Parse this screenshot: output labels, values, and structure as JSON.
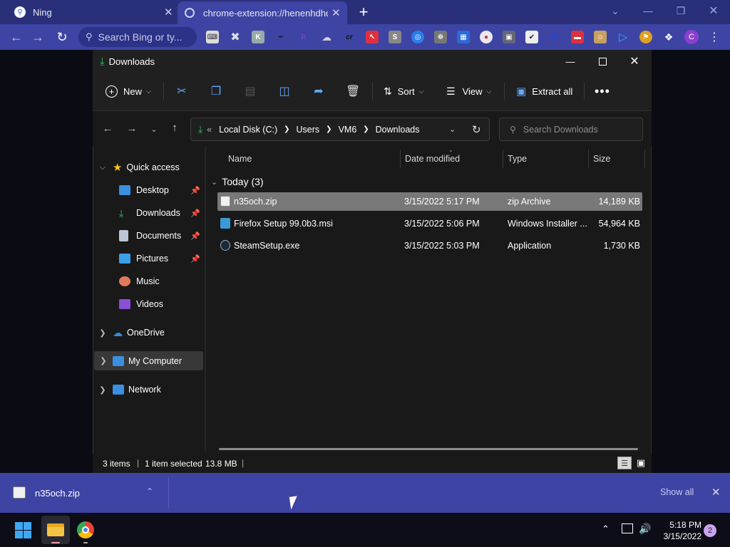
{
  "browser": {
    "tabs": [
      {
        "title": "Ning",
        "icon": "search-icon"
      },
      {
        "title": "chrome-extension://henenhdhdl",
        "icon": "globe-icon"
      }
    ],
    "new_tab": "+",
    "omnibox_placeholder": "Search Bing or ty...",
    "profile_initial": "C",
    "extensions": [
      "⌨",
      "✖",
      "K",
      "✒",
      "R",
      "☁",
      "cr",
      "↖",
      "S",
      "◎",
      "☸",
      "▦",
      "●",
      "▣",
      "✔",
      "R",
      "▬",
      "☺",
      "▷",
      "⚑"
    ]
  },
  "explorer": {
    "title": "Downloads",
    "commands": {
      "new": "New",
      "sort": "Sort",
      "view": "View",
      "extract_all": "Extract all"
    },
    "address": {
      "prefix": "«",
      "crumbs": [
        "Local Disk (C:)",
        "Users",
        "VM6",
        "Downloads"
      ]
    },
    "search_placeholder": "Search Downloads",
    "sidebar": {
      "quick_access": "Quick access",
      "quick_items": [
        {
          "label": "Desktop",
          "pinned": true
        },
        {
          "label": "Downloads",
          "pinned": true
        },
        {
          "label": "Documents",
          "pinned": true
        },
        {
          "label": "Pictures",
          "pinned": true
        },
        {
          "label": "Music",
          "pinned": false
        },
        {
          "label": "Videos",
          "pinned": false
        }
      ],
      "onedrive": "OneDrive",
      "my_computer": "My Computer",
      "network": "Network"
    },
    "columns": {
      "name": "Name",
      "date": "Date modified",
      "type": "Type",
      "size": "Size"
    },
    "group": "Today (3)",
    "files": [
      {
        "name": "n35och.zip",
        "date": "3/15/2022 5:17 PM",
        "type": "zip Archive",
        "size": "14,189 KB",
        "selected": true
      },
      {
        "name": "Firefox Setup 99.0b3.msi",
        "date": "3/15/2022 5:06 PM",
        "type": "Windows Installer ...",
        "size": "54,964 KB",
        "selected": false
      },
      {
        "name": "SteamSetup.exe",
        "date": "3/15/2022 5:03 PM",
        "type": "Application",
        "size": "1,730 KB",
        "selected": false
      }
    ],
    "status": {
      "items": "3 items",
      "selected": "1 item selected",
      "size": "13.8 MB"
    }
  },
  "download_bar": {
    "file": "n35och.zip",
    "show_all": "Show all"
  },
  "taskbar": {
    "time": "5:18 PM",
    "date": "3/15/2022",
    "notifications": "2"
  },
  "colors": {
    "chrome_tabstrip": "#2a2f7a",
    "chrome_toolbar": "#3d44a3",
    "explorer_bg": "#191919",
    "accent_blue": "#62a8ff",
    "selection": "#787878"
  }
}
